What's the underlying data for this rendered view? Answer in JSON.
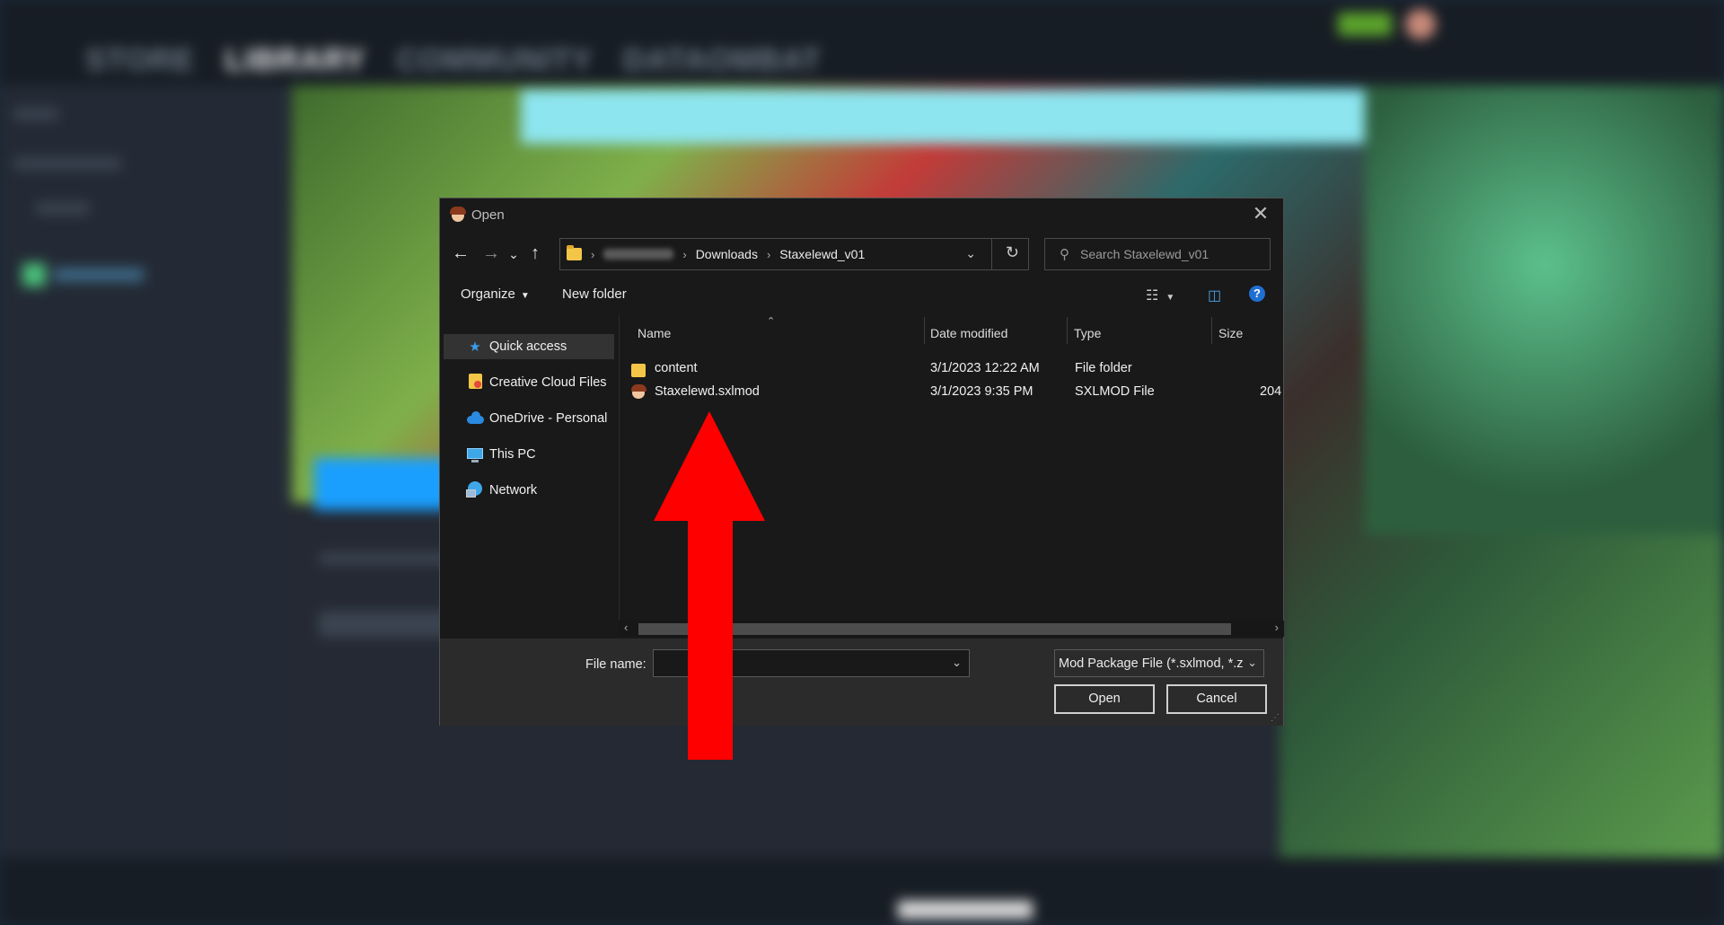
{
  "steam": {
    "nav": [
      "STORE",
      "LIBRARY",
      "COMMUNITY",
      "DATAOMBAT"
    ]
  },
  "dialog": {
    "title": "Open",
    "close_glyph": "✕",
    "nav": {
      "back": "←",
      "forward": "→",
      "recent": "⌄",
      "up": "↑"
    },
    "address": {
      "crumbs": [
        "Downloads",
        "Staxelewd_v01"
      ],
      "refresh": "↻"
    },
    "search": {
      "placeholder": "Search Staxelewd_v01"
    },
    "toolbar": {
      "organize": "Organize",
      "new_folder": "New folder"
    },
    "sidebar": {
      "items": [
        {
          "label": "Quick access",
          "icon": "star-icon",
          "selected": true
        },
        {
          "label": "Creative Cloud Files",
          "icon": "creative-cloud-folder-icon"
        },
        {
          "label": "OneDrive - Personal",
          "icon": "cloud-icon"
        },
        {
          "label": "This PC",
          "icon": "monitor-icon"
        },
        {
          "label": "Network",
          "icon": "network-icon"
        }
      ]
    },
    "columns": [
      "Name",
      "Date modified",
      "Type",
      "Size"
    ],
    "files": [
      {
        "name": "content",
        "date": "3/1/2023 12:22 AM",
        "type": "File folder",
        "size": "",
        "icon": "folder-icon"
      },
      {
        "name": "Staxelewd.sxlmod",
        "date": "3/1/2023 9:35 PM",
        "type": "SXLMOD File",
        "size": "204",
        "icon": "mod-file-icon"
      }
    ],
    "footer": {
      "file_name_label": "File name:",
      "file_name_value": "",
      "file_type": "Mod Package File (*.sxlmod, *.z",
      "open": "Open",
      "cancel": "Cancel"
    }
  },
  "colors": {
    "dialog_bg": "#191919",
    "footer_bg": "#2b2b2b",
    "arrow": "#ff0000",
    "help": "#1f6fd1"
  }
}
